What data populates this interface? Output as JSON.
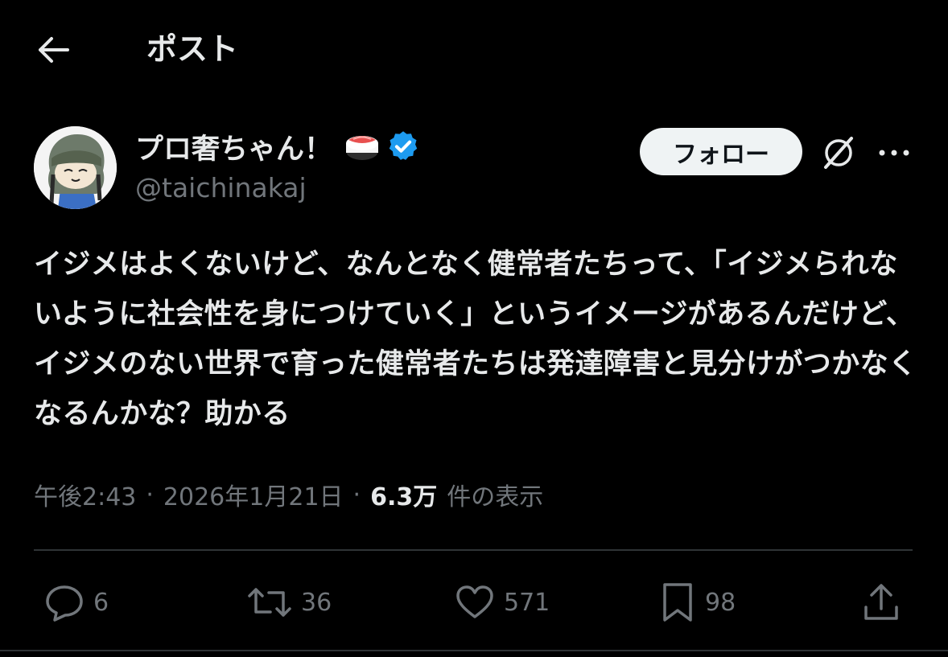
{
  "header": {
    "title": "ポスト",
    "back_icon": "arrow-left-icon"
  },
  "author": {
    "name": "プロ奢ちゃん！",
    "handle": "@taichinakaj",
    "emoji": "sushi-icon",
    "verified_icon": "verified-badge-icon",
    "verified_color": "#1d9bf0"
  },
  "follow_button": {
    "label": "フォロー"
  },
  "post": {
    "text": "イジメはよくないけど、なんとなく健常者たちって、「イジメられないように社会性を身につけていく」というイメージがあるんだけど、イジメのない世界で育った健常者たちは発達障害と見分けがつかなくなるんかな？助かる",
    "time": "午後2:43",
    "date": "2026年1月21日",
    "separator": "·",
    "views_count": "6.3万",
    "views_label": "件の表示"
  },
  "actions": {
    "reply_count": "6",
    "repost_count": "36",
    "like_count": "571",
    "bookmark_count": "98"
  },
  "colors": {
    "background": "#000000",
    "text": "#e7e9ea",
    "muted": "#71767b",
    "divider": "#2f3336",
    "button_bg": "#eff3f4"
  }
}
